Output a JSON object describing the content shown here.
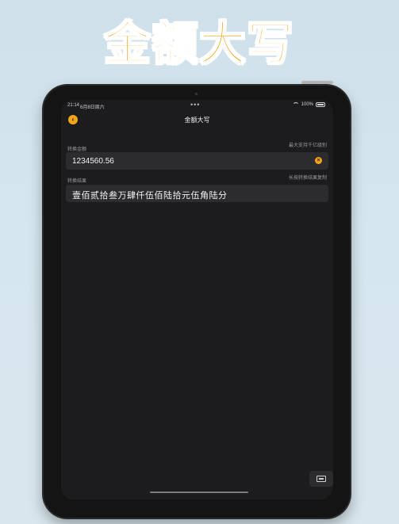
{
  "promo": {
    "title": "金额大写"
  },
  "status_bar": {
    "time": "21:14",
    "date": "6月8日周六",
    "battery": "100%"
  },
  "nav": {
    "title": "金额大写",
    "back_icon": "chevron-left"
  },
  "input_section": {
    "label": "转换金额",
    "hint": "最大支持千亿级别",
    "value": "1234560.56",
    "clear_icon": "xmark"
  },
  "result_section": {
    "label": "转换结果",
    "hint": "长按转换结果复制",
    "value": "壹佰贰拾叁万肆仟伍佰陆拾元伍角陆分"
  },
  "colors": {
    "accent": "#f5a31a",
    "screen_bg": "#1c1c1e",
    "field_bg": "#2c2c2e"
  }
}
